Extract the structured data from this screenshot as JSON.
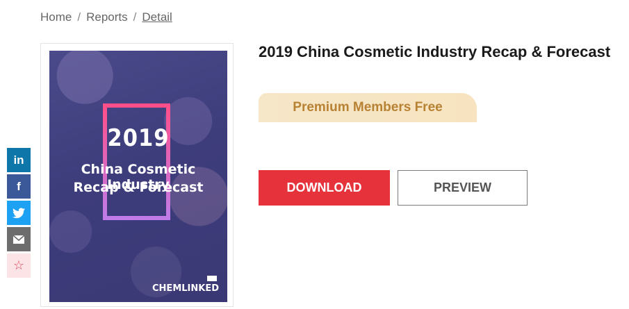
{
  "breadcrumb": {
    "items": [
      "Home",
      "Reports",
      "Detail"
    ],
    "separator": "/"
  },
  "share": {
    "linkedin": "in",
    "facebook": "f",
    "twitter": "🐦",
    "email": "✉",
    "favorite": "☆"
  },
  "cover": {
    "year": "2019",
    "title_line1": "China Cosmetic Industry",
    "title_line2": "Recap & Forecast",
    "brand": "CHEMLINKED"
  },
  "report": {
    "title": "2019 China Cosmetic Industry Recap & Forecast",
    "badge": "Premium Members Free",
    "download_label": "DOWNLOAD",
    "preview_label": "PREVIEW"
  },
  "colors": {
    "download_bg": "#e5323b",
    "badge_text": "#b88234",
    "linkedin": "#0e76a8",
    "facebook": "#3b5998",
    "twitter": "#1da1f2"
  }
}
